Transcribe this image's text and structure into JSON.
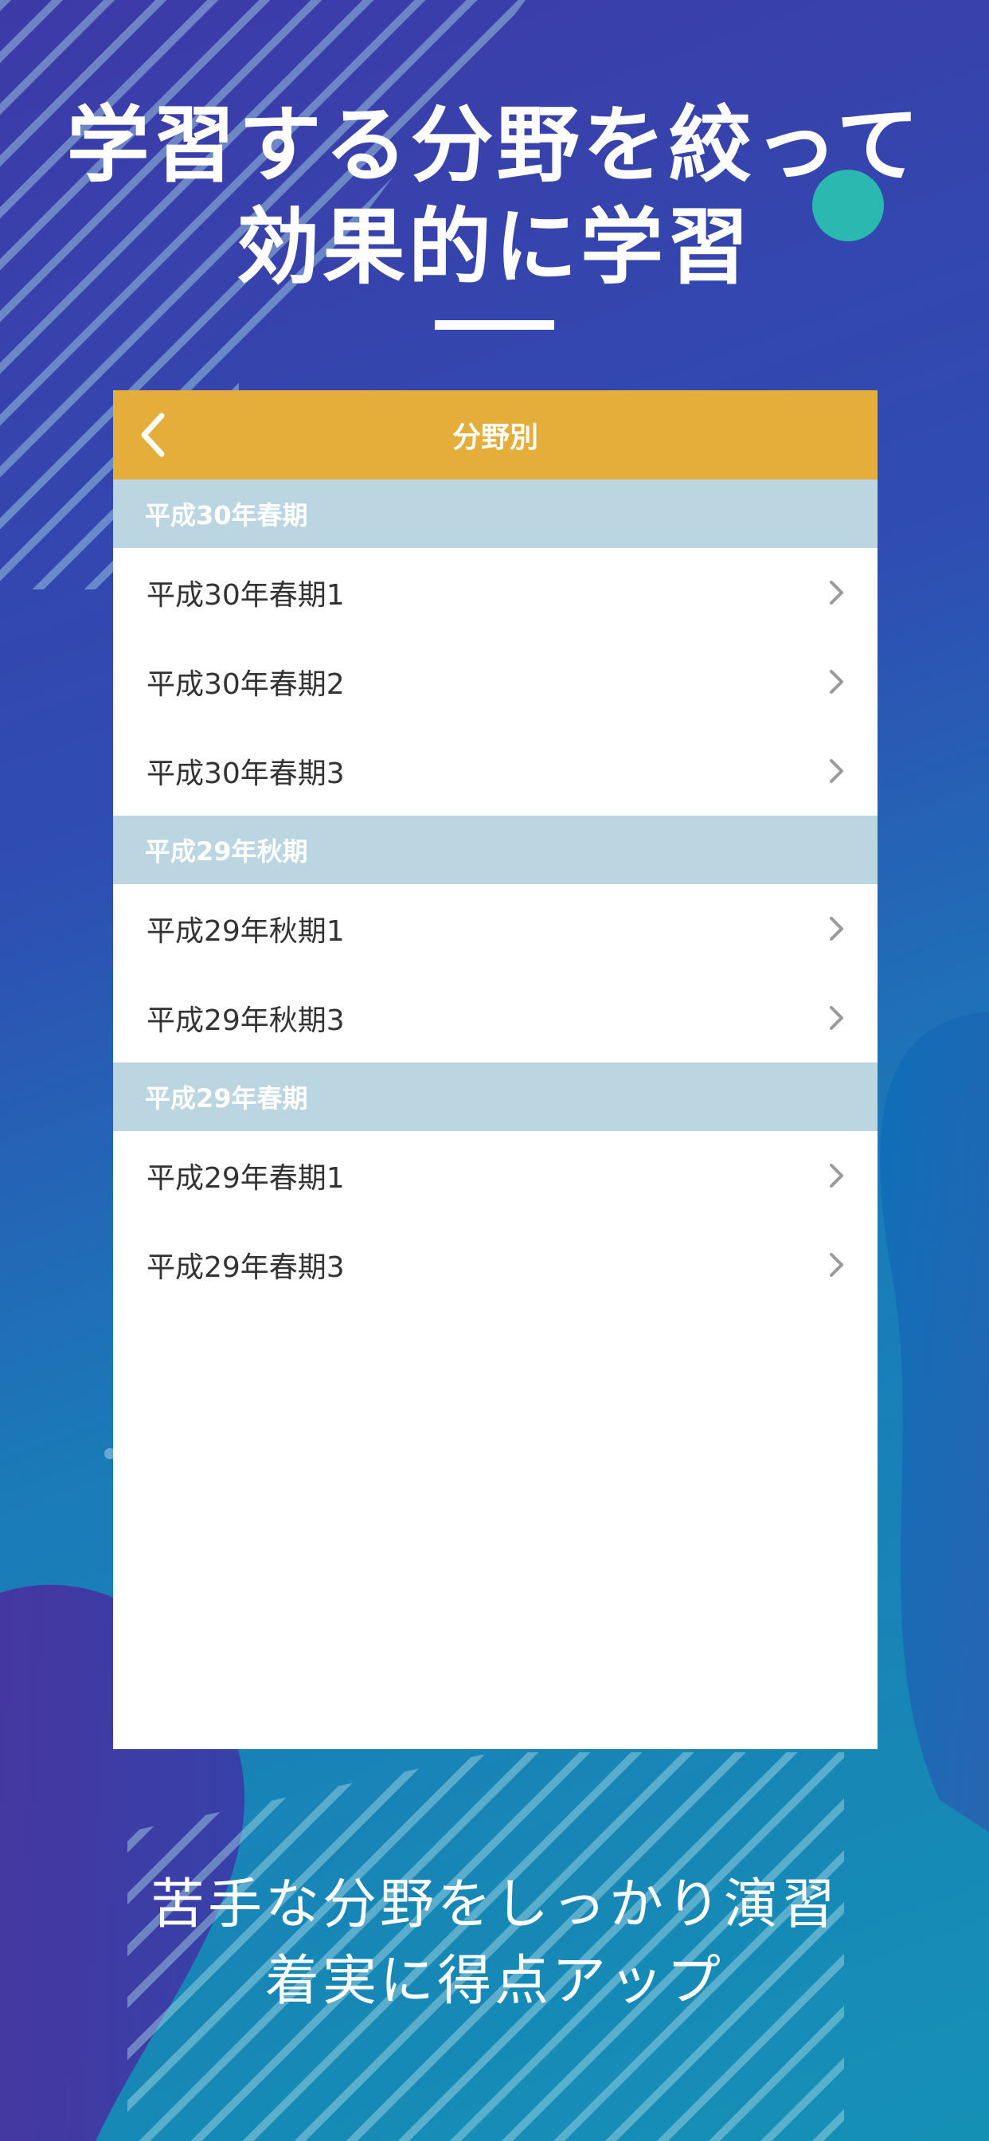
{
  "headline": {
    "line1": "学習する分野を絞って",
    "line2": "効果的に学習"
  },
  "screen": {
    "title": "分野別",
    "back_icon": "chevron-left-icon",
    "row_icon": "chevron-right-icon",
    "sections": [
      {
        "header": "平成30年春期",
        "rows": [
          "平成30年春期1",
          "平成30年春期2",
          "平成30年春期3"
        ]
      },
      {
        "header": "平成29年秋期",
        "rows": [
          "平成29年秋期1",
          "平成29年秋期3"
        ]
      },
      {
        "header": "平成29年春期",
        "rows": [
          "平成29年春期1",
          "平成29年春期3"
        ]
      }
    ]
  },
  "footer": {
    "line1": "苦手な分野をしっかり演習",
    "line2": "着実に得点アップ"
  },
  "colors": {
    "nav_bar": "#e5ad3a",
    "section_header": "#bcd6e1",
    "row_text": "#333333",
    "chevron": "#9a9a9a",
    "accent_circle": "#2ab8b0"
  }
}
